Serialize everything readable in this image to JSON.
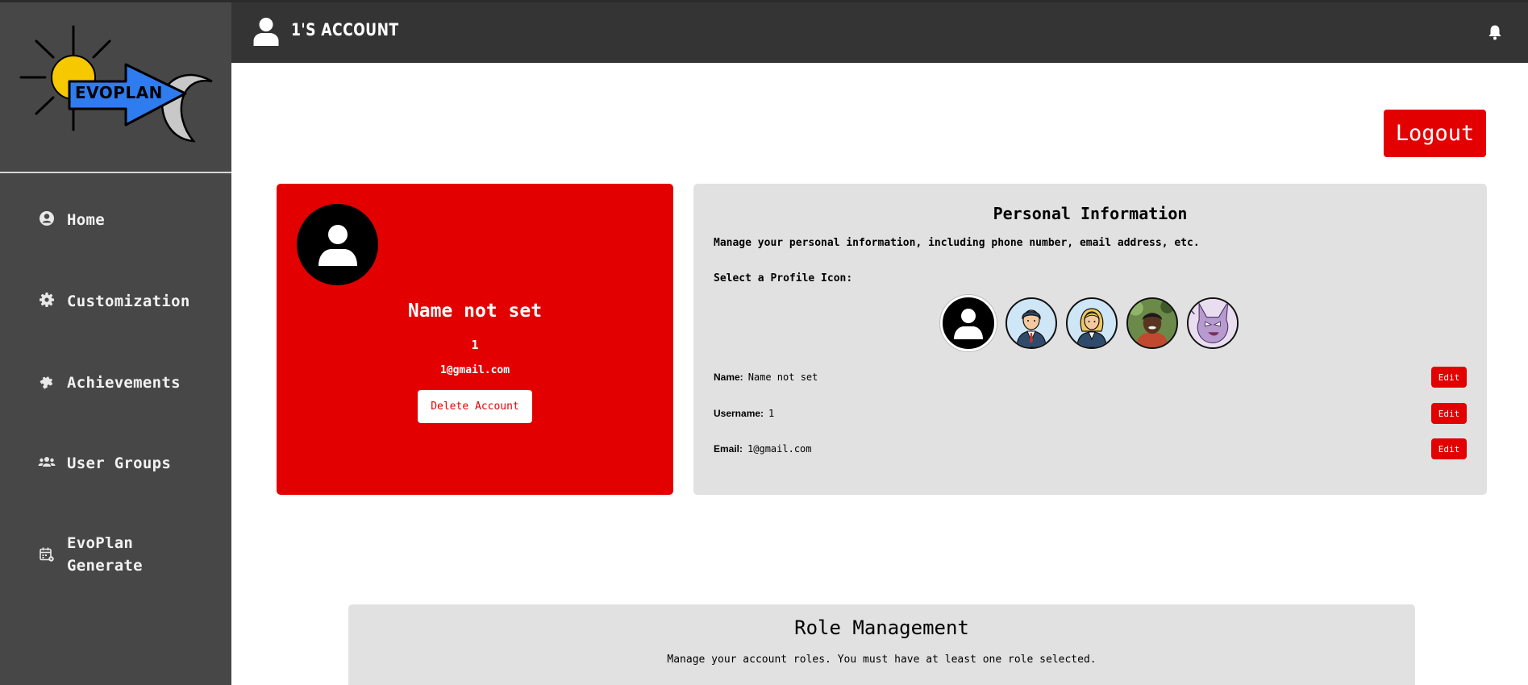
{
  "app": {
    "logo_text": "EVOPLAN"
  },
  "header": {
    "title": "1'S ACCOUNT"
  },
  "sidebar": {
    "items": [
      {
        "label": "Home",
        "icon": "user-circle-icon"
      },
      {
        "label": "Customization",
        "icon": "gear-icon"
      },
      {
        "label": "Achievements",
        "icon": "puzzle-icon"
      },
      {
        "label": "User Groups",
        "icon": "users-icon"
      },
      {
        "label": "EvoPlan Generate",
        "icon": "calendar-gear-icon"
      }
    ]
  },
  "actions": {
    "logout_label": "Logout"
  },
  "profile": {
    "name": "Name not set",
    "username": "1",
    "email": "1@gmail.com",
    "delete_label": "Delete Account"
  },
  "personal_info": {
    "title": "Personal Information",
    "description": "Manage your personal information, including phone number, email address, etc.",
    "icon_select_label": "Select a Profile Icon:",
    "icon_options": [
      "default-user-icon",
      "man-avatar-icon",
      "woman-avatar-icon",
      "photo-avatar-icon",
      "cat-avatar-icon"
    ],
    "selected_icon": "default-user-icon",
    "fields": [
      {
        "label": "Name:",
        "value": "Name not set",
        "edit_label": "Edit"
      },
      {
        "label": "Username:",
        "value": "1",
        "edit_label": "Edit"
      },
      {
        "label": "Email:",
        "value": "1@gmail.com",
        "edit_label": "Edit"
      }
    ]
  },
  "role_management": {
    "title": "Role Management",
    "description": "Manage your account roles. You must have at least one role selected."
  },
  "colors": {
    "accent": "#e30000",
    "sidebar": "#474747",
    "header": "#343434",
    "card": "#e1e1e1"
  }
}
